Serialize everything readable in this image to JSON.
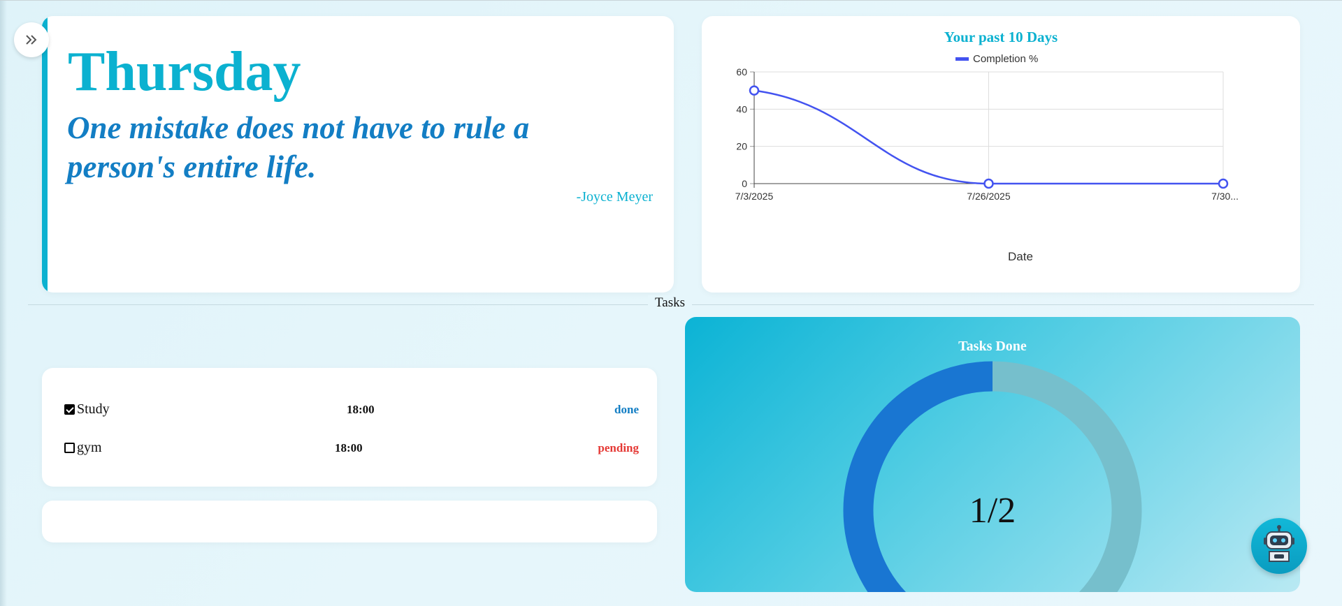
{
  "quote_card": {
    "day": "Thursday",
    "quote": "One mistake does not have to rule a person's entire life.",
    "author": "-Joyce Meyer"
  },
  "chart_data": {
    "type": "line",
    "title": "Your past 10 Days",
    "legend": "Completion %",
    "legend_position": "top",
    "xlabel": "Date",
    "ylabel": "",
    "categories": [
      "7/3/2025",
      "7/26/2025",
      "7/30..."
    ],
    "series": [
      {
        "name": "Completion %",
        "values": [
          50,
          0,
          0
        ]
      }
    ],
    "ylim": [
      0,
      60
    ],
    "yticks": [
      0,
      20,
      40,
      60
    ],
    "grid": true,
    "colors": {
      "line": "#4353f0",
      "title": "#0bb1d0"
    }
  },
  "divider": {
    "label": "Tasks"
  },
  "tasks": [
    {
      "name": "Study",
      "time": "18:00",
      "status": "done",
      "checked": true
    },
    {
      "name": "gym",
      "time": "18:00",
      "status": "pending",
      "checked": false
    }
  ],
  "gauge": {
    "title": "Tasks Done",
    "value_text": "1/2",
    "done": 1,
    "total": 2,
    "colors": {
      "done": "#1976d2",
      "remaining": "#76bfcc"
    }
  },
  "icons": {
    "toggle": "double-chevron-right-icon",
    "assistant": "robot-icon"
  }
}
